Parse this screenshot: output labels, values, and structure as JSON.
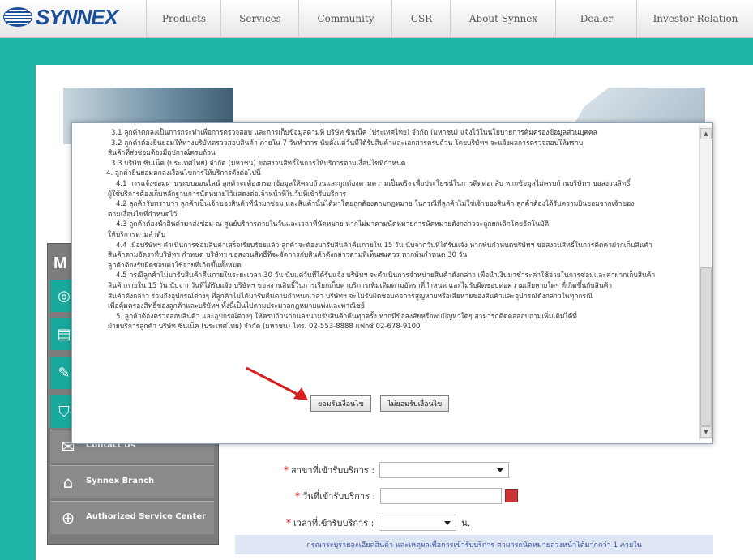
{
  "brand": {
    "name": "SYNNEX"
  },
  "nav": {
    "items": [
      "Products",
      "Services",
      "Community",
      "CSR",
      "About Synnex",
      "Dealer",
      "Investor Relation"
    ]
  },
  "sidebar": {
    "title": "M",
    "items": [
      {
        "label": "Contact Us",
        "icon": "mail-icon"
      },
      {
        "label": "Synnex Branch",
        "icon": "home-icon"
      },
      {
        "label": "Authorized Service Center",
        "icon": "globe-icon"
      }
    ]
  },
  "form": {
    "fields": [
      {
        "label": "สาขาที่เข้ารับบริการ :",
        "type": "select",
        "value": ""
      },
      {
        "label": "วันที่เข้ารับบริการ :",
        "type": "date",
        "value": ""
      },
      {
        "label": "เวลาที่เข้ารับบริการ :",
        "type": "select",
        "value": "",
        "suffix": "น."
      }
    ],
    "info": "กรุณาระบุรายละเอียดสินค้า และเหตุผลเพื่อการเข้ารับบริการ สามารถนัดหมายล่วงหน้าได้มากกว่า 1 ภายใน"
  },
  "dialog": {
    "paragraphs": [
      "3.1 ลูกค้าตกลงเป็นการกระทำเพื่อการตรวจสอบ และการเก็บข้อมูลตามที่ บริษัท ซินเน็ค (ประเทศไทย) จำกัด (มหาชน) แจ้งไว้ในนโยบายการคุ้มครองข้อมูลส่วนบุคคล",
      "3.2 ลูกค้าต้องยินยอมให้ทางบริษัทตรวจสอบสินค้า ภายใน 7 วันทำการ นับตั้งแต่วันที่ได้รับสินค้าและเอกสารครบถ้วน โดยบริษัทฯ จะแจ้งผลการตรวจสอบให้ทราบ",
      "สินค้าที่ส่งซ่อมต้องมีอุปกรณ์ครบถ้วน",
      "3.3 บริษัท ซินเน็ค (ประเทศไทย) จำกัด (มหาชน) ขอสงวนสิทธิ์ในการให้บริการตามเงื่อนไขที่กำหนด",
      "4. ลูกค้ายินยอมตกลงเงื่อนไขการให้บริการดังต่อไปนี้",
      "4.1 การแจ้งซ่อมผ่านระบบออนไลน์ ลูกค้าจะต้องกรอกข้อมูลให้ครบถ้วนและถูกต้องตามความเป็นจริง เพื่อประโยชน์ในการติดต่อกลับ หากข้อมูลไม่ครบถ้วนบริษัทฯ ขอสงวนสิทธิ์",
      "ผู้ใช้บริการต้องเก็บหลักฐานการนัดหมายไว้แสดงต่อเจ้าหน้าที่ในวันที่เข้ารับบริการ",
      "4.2 ลูกค้ารับทราบว่า ลูกค้าเป็นเจ้าของสินค้าที่นำมาซ่อม และสินค้านั้นได้มาโดยถูกต้องตามกฎหมาย ในกรณีที่ลูกค้าไม่ใช่เจ้าของสินค้า ลูกค้าต้องได้รับความยินยอมจากเจ้าของ",
      "ตามเงื่อนไขที่กำหนดไว้",
      "4.3 ลูกค้าต้องนำสินค้ามาส่งซ่อม ณ ศูนย์บริการภายในวันและเวลาที่นัดหมาย หากไม่มาตามนัดหมายการนัดหมายดังกล่าวจะถูกยกเลิกโดยอัตโนมัติ",
      "ให้บริการตามลำดับ",
      "4.4 เมื่อบริษัทฯ ดำเนินการซ่อมสินค้าเสร็จเรียบร้อยแล้ว ลูกค้าจะต้องมารับสินค้าคืนภายใน 15 วัน นับจากวันที่ได้รับแจ้ง หากพ้นกำหนดบริษัทฯ ขอสงวนสิทธิ์ในการคิดค่าฝากเก็บสินค้า",
      "สินค้าตามอัตราที่บริษัทฯ กำหนด บริษัทฯ ขอสงวนสิทธิ์ที่จะจัดการกับสินค้าดังกล่าวตามที่เห็นสมควร หากพ้นกำหนด 30 วัน",
      "ลูกค้าต้องรับผิดชอบค่าใช้จ่ายที่เกิดขึ้นทั้งหมด",
      "4.5 กรณีลูกค้าไม่มารับสินค้าคืนภายในระยะเวลา 30 วัน นับแต่วันที่ได้รับแจ้ง บริษัทฯ จะดำเนินการจำหน่ายสินค้าดังกล่าว เพื่อนำเงินมาชำระค่าใช้จ่ายในการซ่อมและค่าฝากเก็บสินค้า",
      "สินค้าภายใน 15 วัน นับจากวันที่ได้รับแจ้ง บริษัทฯ ขอสงวนสิทธิ์ในการเรียกเก็บค่าบริการเพิ่มเติมตามอัตราที่กำหนด และไม่รับผิดชอบต่อความเสียหายใดๆ ที่เกิดขึ้นกับสินค้า",
      "สินค้าดังกล่าว รวมถึงอุปกรณ์ต่างๆ ที่ลูกค้าไม่ได้มารับคืนตามกำหนดเวลา บริษัทฯ จะไม่รับผิดชอบต่อการสูญหายหรือเสียหายของสินค้าและอุปกรณ์ดังกล่าวในทุกกรณี",
      "เพื่อคุ้มครองสิทธิ์ของลูกค้าและบริษัทฯ ทั้งนี้เป็นไปตามประมวลกฎหมายแพ่งและพาณิชย์",
      "5. ลูกค้าต้องตรวจสอบสินค้า และอุปกรณ์ต่างๆ ให้ครบถ้วนก่อนลงนามรับสินค้าคืนทุกครั้ง หากมีข้อสงสัยหรือพบปัญหาใดๆ สามารถติดต่อสอบถามเพิ่มเติมได้ที่",
      "ฝ่ายบริการลูกค้า บริษัท ซินเน็ค (ประเทศไทย) จำกัด (มหาชน) โทร. 02-553-8888 แฟกซ์ 02-678-9100"
    ],
    "accept_label": "ยอมรับเงื่อนไข",
    "decline_label": "ไม่ยอมรับเงื่อนไข"
  },
  "colors": {
    "page_bg": "#20b5a8",
    "brand_blue": "#1b4e9b",
    "arrow": "#d62020"
  }
}
